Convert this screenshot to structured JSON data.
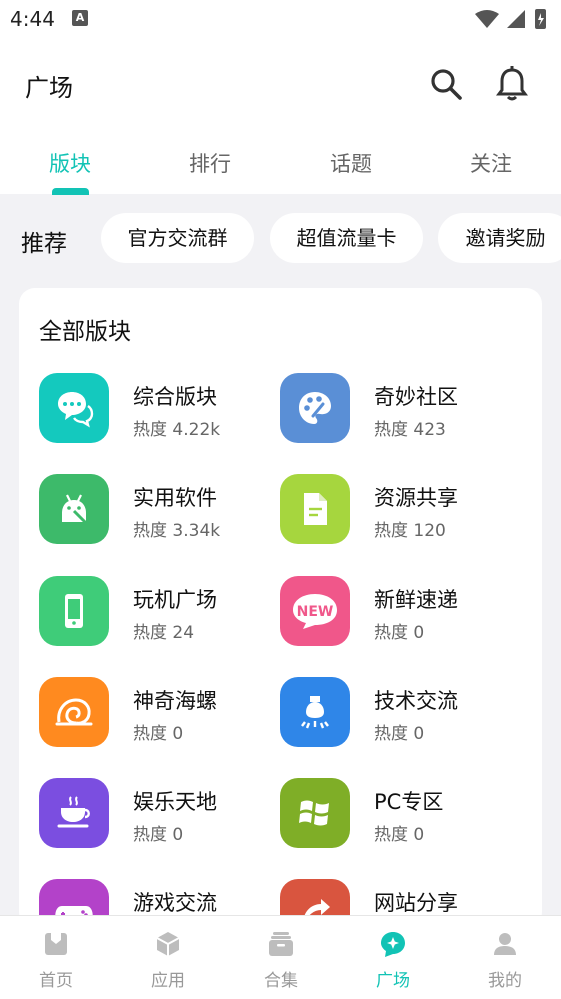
{
  "status_bar": {
    "time": "4:44",
    "notification_icon_letter": "A"
  },
  "app_bar": {
    "title": "广场",
    "icons": [
      "search-icon",
      "bell-icon"
    ]
  },
  "tabs": [
    {
      "label": "版块",
      "active": true
    },
    {
      "label": "排行",
      "active": false
    },
    {
      "label": "话题",
      "active": false
    },
    {
      "label": "关注",
      "active": false
    }
  ],
  "recommend": {
    "label": "推荐",
    "chips": [
      "官方交流群",
      "超值流量卡",
      "邀请奖励"
    ]
  },
  "sections": {
    "title": "全部版块",
    "items": [
      {
        "name": "综合版块",
        "heat": "热度 4.22k",
        "icon": "chat-bubbles-icon",
        "color": "#14c9be"
      },
      {
        "name": "奇妙社区",
        "heat": "热度 423",
        "icon": "palette-icon",
        "color": "#5a8fd6"
      },
      {
        "name": "实用软件",
        "heat": "热度 3.34k",
        "icon": "android-icon",
        "color": "#3dba6a"
      },
      {
        "name": "资源共享",
        "heat": "热度 120",
        "icon": "document-icon",
        "color": "#a6d63e"
      },
      {
        "name": "玩机广场",
        "heat": "热度 24",
        "icon": "phone-icon",
        "color": "#3fcc79"
      },
      {
        "name": "新鲜速递",
        "heat": "热度 0",
        "icon": "new-badge-icon",
        "color": "#f0578a"
      },
      {
        "name": "神奇海螺",
        "heat": "热度 0",
        "icon": "conch-icon",
        "color": "#ff8a1f"
      },
      {
        "name": "技术交流",
        "heat": "热度 0",
        "icon": "lightbulb-icon",
        "color": "#2f86e8"
      },
      {
        "name": "娱乐天地",
        "heat": "热度 0",
        "icon": "coffee-icon",
        "color": "#7b4ee0"
      },
      {
        "name": "PC专区",
        "heat": "热度 0",
        "icon": "windows-icon",
        "color": "#7fae27"
      },
      {
        "name": "游戏交流",
        "heat": "",
        "icon": "gamepad-icon",
        "color": "#b342c9"
      },
      {
        "name": "网站分享",
        "heat": "",
        "icon": "web-share-icon",
        "color": "#d9553f"
      }
    ]
  },
  "bottom_nav": [
    {
      "label": "首页",
      "icon": "home-icon",
      "active": false
    },
    {
      "label": "应用",
      "icon": "cube-icon",
      "active": false
    },
    {
      "label": "合集",
      "icon": "archive-icon",
      "active": false
    },
    {
      "label": "广场",
      "icon": "square-chat-icon",
      "active": true
    },
    {
      "label": "我的",
      "icon": "person-icon",
      "active": false
    }
  ],
  "colors": {
    "accent": "#12c3b5",
    "background": "#f2f2f5"
  }
}
